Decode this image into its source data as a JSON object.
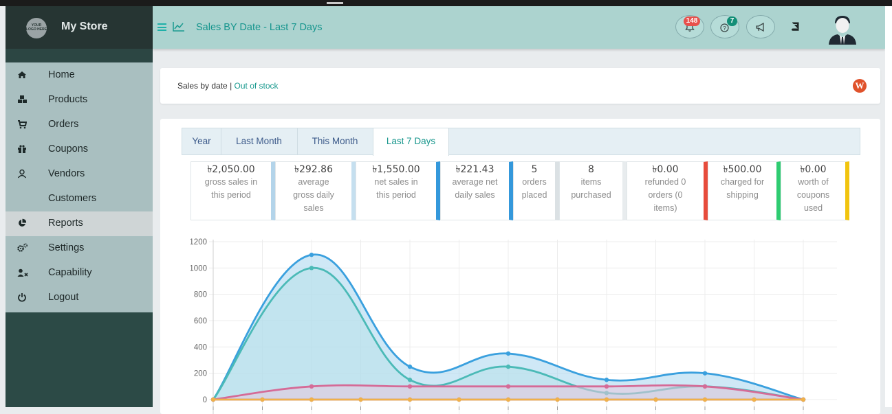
{
  "app": {
    "logo_text": "YOUR LOGO HERE",
    "name": "My Store"
  },
  "header": {
    "title": "Sales BY Date - Last 7 Days",
    "notifications_count": "148",
    "help_count": "7"
  },
  "sidebar": {
    "items": [
      {
        "label": "Home",
        "icon": "home-icon"
      },
      {
        "label": "Products",
        "icon": "cubes-icon"
      },
      {
        "label": "Orders",
        "icon": "cart-icon"
      },
      {
        "label": "Coupons",
        "icon": "gift-icon"
      },
      {
        "label": "Vendors",
        "icon": "user-icon"
      },
      {
        "label": "Customers",
        "icon": ""
      },
      {
        "label": "Reports",
        "icon": "pie-chart-icon"
      },
      {
        "label": "Settings",
        "icon": "cogs-icon"
      },
      {
        "label": "Capability",
        "icon": "user-times-icon"
      },
      {
        "label": "Logout",
        "icon": "power-icon"
      }
    ],
    "active": "Reports"
  },
  "breadcrumb": {
    "current": "Sales by date",
    "separator": "|",
    "link": "Out of stock"
  },
  "tabs": [
    {
      "label": "Year"
    },
    {
      "label": "Last Month"
    },
    {
      "label": "This Month"
    },
    {
      "label": "Last 7 Days"
    }
  ],
  "active_tab": "Last 7 Days",
  "stats": [
    {
      "value": "৳2,050.00",
      "lines": [
        "gross sales in",
        "this period"
      ],
      "color": "#b3d4ea"
    },
    {
      "value": "৳292.86",
      "lines": [
        "average",
        "gross daily",
        "sales"
      ],
      "color": "#c5dfef"
    },
    {
      "value": "৳1,550.00",
      "lines": [
        "net sales in",
        "this period"
      ],
      "color": "#3498db"
    },
    {
      "value": "৳221.43",
      "lines": [
        "average net",
        "daily sales"
      ],
      "color": "#3498db"
    },
    {
      "value": "5",
      "lines": [
        "orders",
        "placed"
      ],
      "color": "#dbe1e4"
    },
    {
      "value": "8",
      "lines": [
        "items",
        "purchased"
      ],
      "color": "#e8ecee"
    },
    {
      "value": "৳0.00",
      "lines": [
        "refunded 0",
        "orders (0",
        "items)"
      ],
      "color": "#e74c3c"
    },
    {
      "value": "৳500.00",
      "lines": [
        "charged for",
        "shipping"
      ],
      "color": "#2ecc71"
    },
    {
      "value": "৳0.00",
      "lines": [
        "worth of",
        "coupons",
        "used"
      ],
      "color": "#f1c40f"
    }
  ],
  "chart_data": {
    "type": "area",
    "y_ticks": [
      0,
      200,
      400,
      600,
      800,
      1000,
      1200
    ],
    "ylim": [
      0,
      1200
    ],
    "x": [
      0,
      1,
      2,
      3,
      4,
      5,
      6,
      7,
      8,
      9,
      10,
      11,
      12
    ],
    "grid": true,
    "series": [
      {
        "values": [
          0,
          null,
          1100,
          null,
          250,
          null,
          350,
          null,
          150,
          null,
          200,
          null,
          0
        ],
        "color": "#3aa0de",
        "fill": "#a8d6ee"
      },
      {
        "values": [
          0,
          null,
          1000,
          null,
          150,
          null,
          250,
          null,
          50,
          null,
          100,
          null,
          0
        ],
        "color": "#4bbab7",
        "fill": "#b8e0ea"
      },
      {
        "values": [
          0,
          null,
          100,
          null,
          100,
          null,
          100,
          null,
          100,
          null,
          100,
          null,
          0
        ],
        "color": "#d56b97",
        "fill": "#e8c6dd"
      },
      {
        "values": [
          0,
          0,
          0,
          0,
          0,
          0,
          0,
          0,
          0,
          0,
          0,
          0,
          0
        ],
        "color": "#8f74f0"
      },
      {
        "values": [
          0,
          0,
          0,
          0,
          0,
          0,
          0,
          0,
          0,
          0,
          0,
          0,
          0
        ],
        "color": "#f0b14a"
      }
    ]
  }
}
